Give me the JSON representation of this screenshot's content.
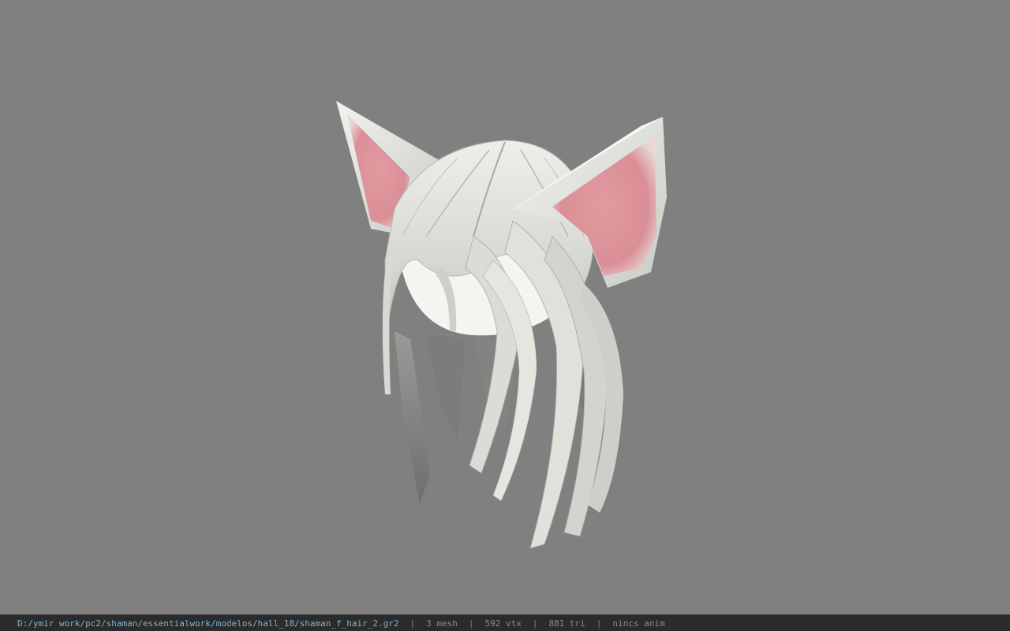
{
  "viewer": {
    "background_color": "#808080",
    "model_icon": "hair-mesh-icon"
  },
  "status": {
    "file_path": "D:/ymir work/pc2/shaman/essentialwork/modelos/hall_18/shaman_f_hair_2.gr2",
    "separator": "|",
    "mesh": "3 mesh",
    "vtx": "592 vtx",
    "tri": "881 tri",
    "anim": "nincs anim",
    "path_color": "#7fb3cf",
    "text_color": "#8a8a8a"
  }
}
